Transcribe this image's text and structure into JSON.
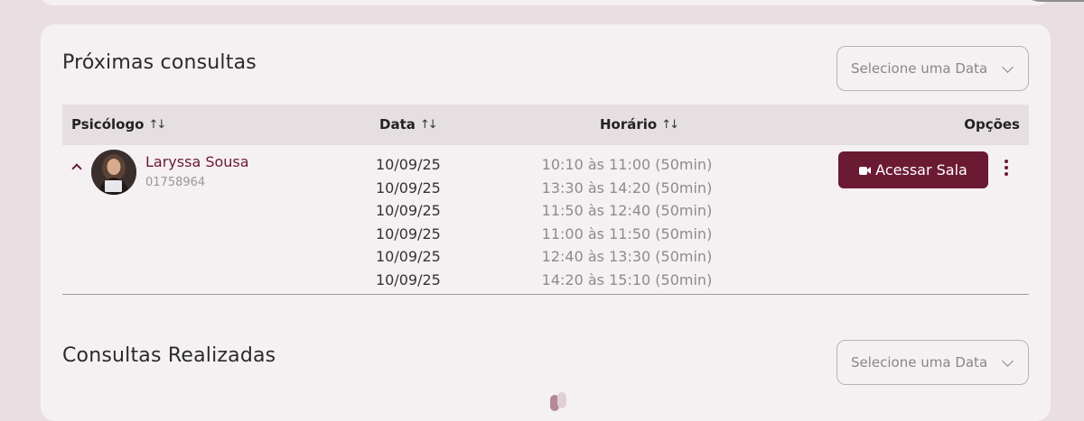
{
  "upcoming": {
    "title": "Próximas consultas",
    "date_select_placeholder": "Selecione uma Data",
    "columns": {
      "psychologist": "Psicólogo",
      "date": "Data",
      "time": "Horário",
      "options": "Opções"
    },
    "rows": [
      {
        "name": "Laryssa Sousa",
        "code": "01758964",
        "dates": [
          "10/09/25",
          "10/09/25",
          "10/09/25",
          "10/09/25",
          "10/09/25",
          "10/09/25"
        ],
        "times": [
          "10:10 às 11:00 (50min)",
          "13:30 às 14:20 (50min)",
          "11:50 às 12:40 (50min)",
          "11:00 às 11:50 (50min)",
          "12:40 às 13:30 (50min)",
          "14:20 às 15:10 (50min)"
        ],
        "action_label": "Acessar Sala"
      }
    ]
  },
  "completed": {
    "title": "Consultas Realizadas",
    "date_select_placeholder": "Selecione uma Data"
  },
  "icons": {
    "sort": "sort-icon",
    "expand": "chevron-up-icon",
    "video": "video-camera-icon",
    "more": "kebab-menu-icon"
  },
  "colors": {
    "brand": "#6b1a33",
    "page_bg": "#e9dfe2",
    "card_bg": "#f5f1f2",
    "header_bg": "#e6dfe1"
  }
}
